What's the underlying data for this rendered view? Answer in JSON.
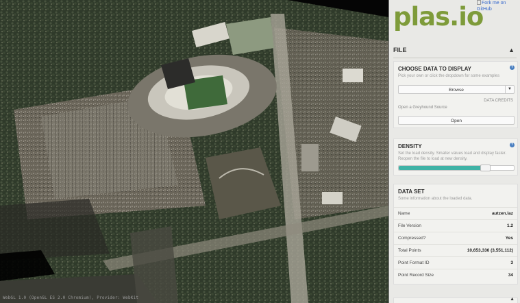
{
  "viewport": {
    "webgl_info": "WebGL 1.0 (OpenGL ES 2.0 Chromium), Provider: WebKit"
  },
  "header": {
    "logo": "plas.io",
    "fork_link": "Fork me on GitHub"
  },
  "file_section": {
    "title": "FILE",
    "choose_data": {
      "title": "CHOOSE DATA TO DISPLAY",
      "description": "Pick your own or click the dropdown for some examples",
      "browse_label": "Browse",
      "data_credits": "DATA CREDITS",
      "greyhound_label": "Open a Greyhound Source",
      "open_label": "Open"
    },
    "density": {
      "title": "DENSITY",
      "description": "Set the load density. Smaller values load and display faster. Reopen the file to load at new density.",
      "value": 0.75
    },
    "data_set": {
      "title": "DATA SET",
      "description": "Some information about the loaded data.",
      "rows": [
        {
          "key": "Name",
          "value": "autzen.laz"
        },
        {
          "key": "File Version",
          "value": "1.2"
        },
        {
          "key": "Compressed?",
          "value": "Yes"
        },
        {
          "key": "Total Points",
          "value": "10,653,336 (3,551,112)"
        },
        {
          "key": "Point Format ID",
          "value": "3"
        },
        {
          "key": "Point Record Size",
          "value": "34"
        }
      ]
    }
  },
  "colors": {
    "logo": "#7e9b3a",
    "density_fill": "#3fb3a6",
    "help_icon": "#4a7fc0"
  }
}
